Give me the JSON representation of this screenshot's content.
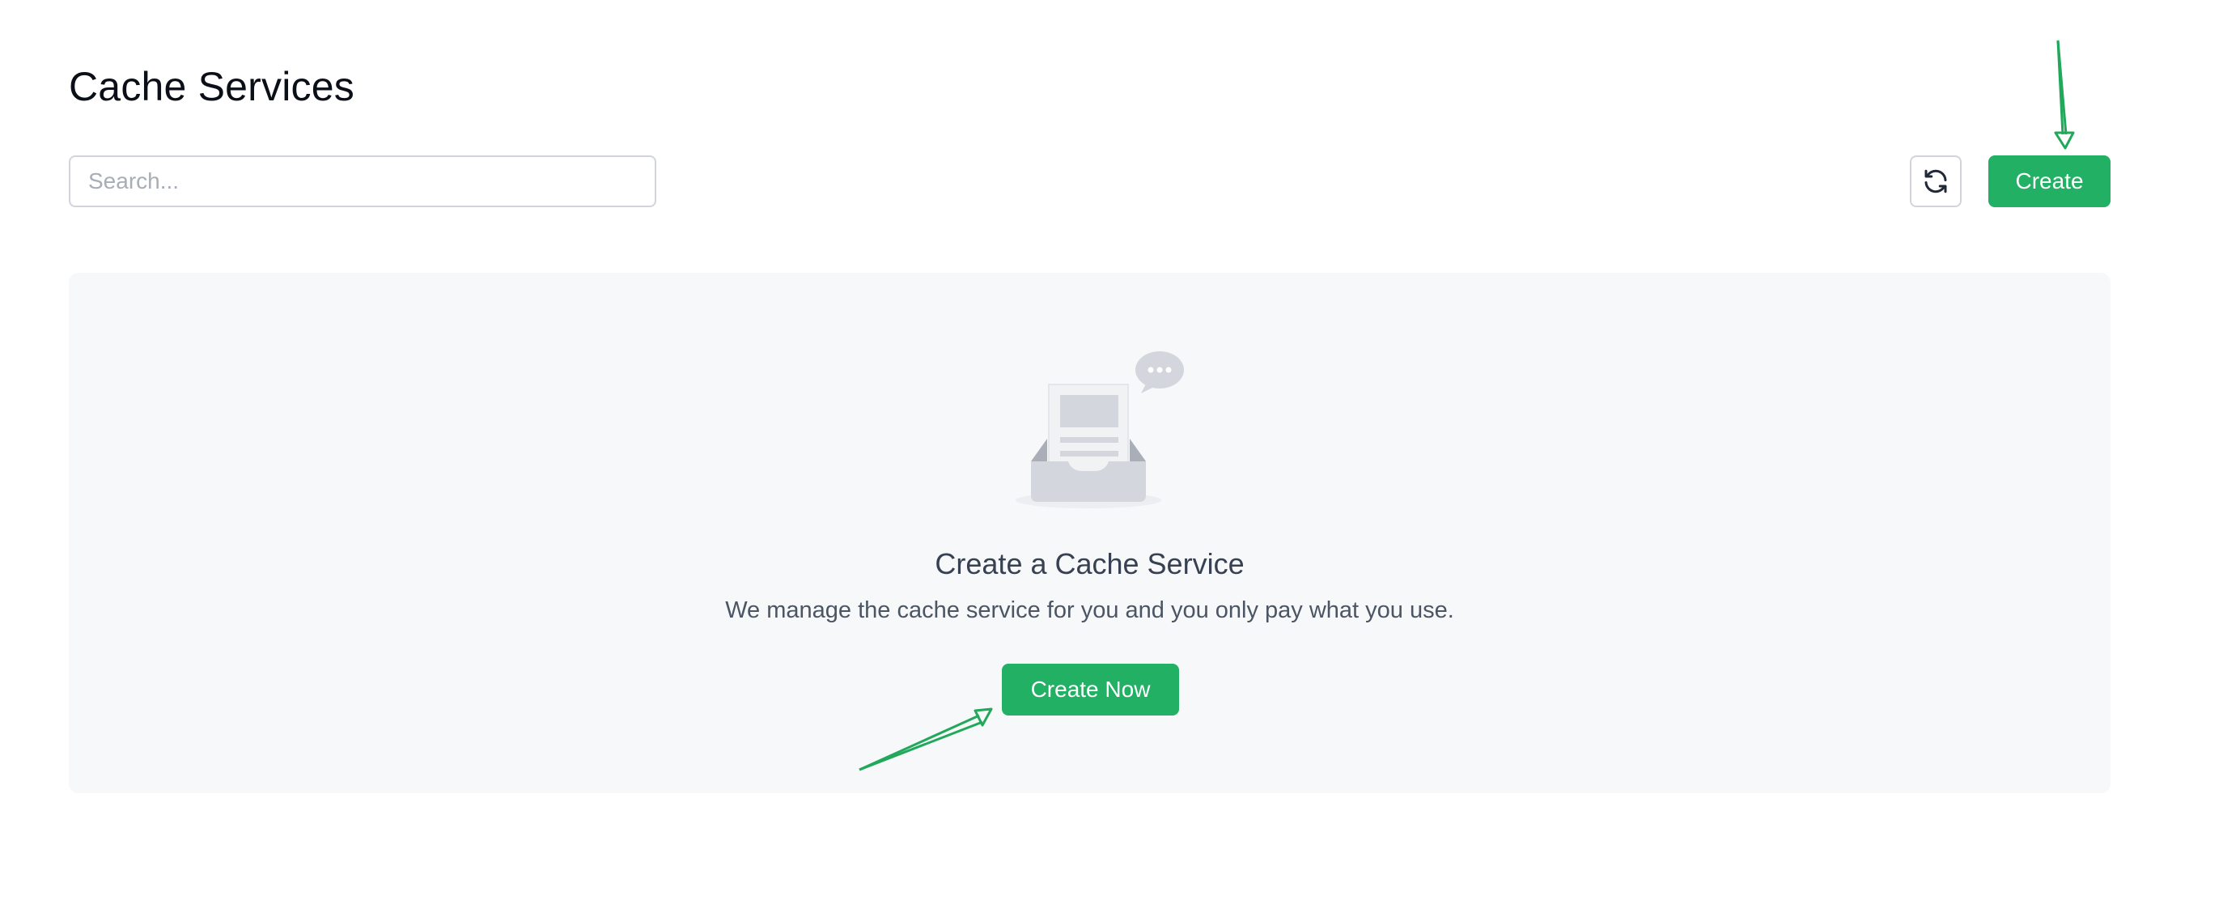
{
  "header": {
    "title": "Cache Services"
  },
  "toolbar": {
    "search_placeholder": "Search...",
    "search_value": "",
    "refresh_icon": "refresh-icon",
    "create_label": "Create"
  },
  "empty_state": {
    "illustration_icon": "empty-inbox-icon",
    "title": "Create a Cache Service",
    "description": "We manage the cache service for you and you only pay what you use.",
    "create_now_label": "Create Now"
  },
  "annotations": {
    "arrow_color": "#21a85a"
  },
  "colors": {
    "accent": "#21b064",
    "panel_background": "#f7f8fa",
    "border": "#d1d5db"
  }
}
